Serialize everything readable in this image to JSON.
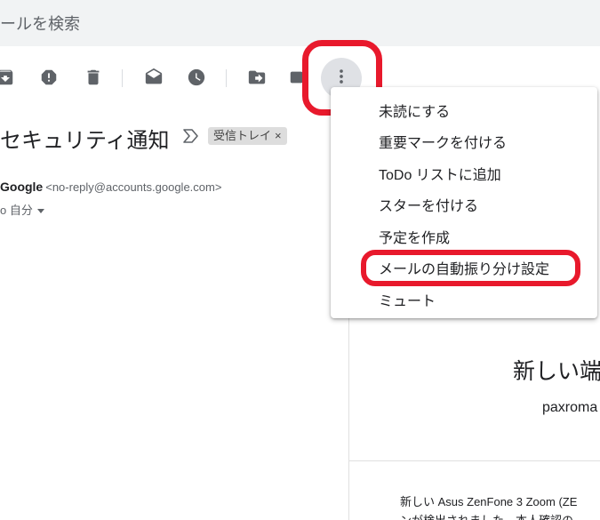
{
  "search": {
    "text": "ールを検索"
  },
  "toolbar": {
    "icons": [
      "archive-icon",
      "report-spam-icon",
      "delete-icon",
      "mark-as-read-icon",
      "snooze-icon",
      "move-to-icon",
      "label-icon",
      "more-options-icon"
    ]
  },
  "email": {
    "subject": "セキュリティ通知",
    "label_chip": "受信トレイ",
    "label_remove": "×",
    "sender_name": "Google",
    "sender_address": "<no-reply@accounts.google.com>",
    "to_line": "o 自分"
  },
  "menu": {
    "items": [
      "未読にする",
      "重要マークを付ける",
      "ToDo リストに追加",
      "スターを付ける",
      "予定を作成",
      "メールの自動振り分け設定",
      "ミュート"
    ],
    "highlighted_index": 5
  },
  "body": {
    "heading": "新しい端",
    "email": "paxroma",
    "text1": "新しい Asus ZenFone 3 Zoom (ZE",
    "text2": "ンが検出されました。本人確認の"
  },
  "colors": {
    "highlight": "#e8192c",
    "icon": "#5f6368",
    "search_bg": "#f1f3f4"
  }
}
